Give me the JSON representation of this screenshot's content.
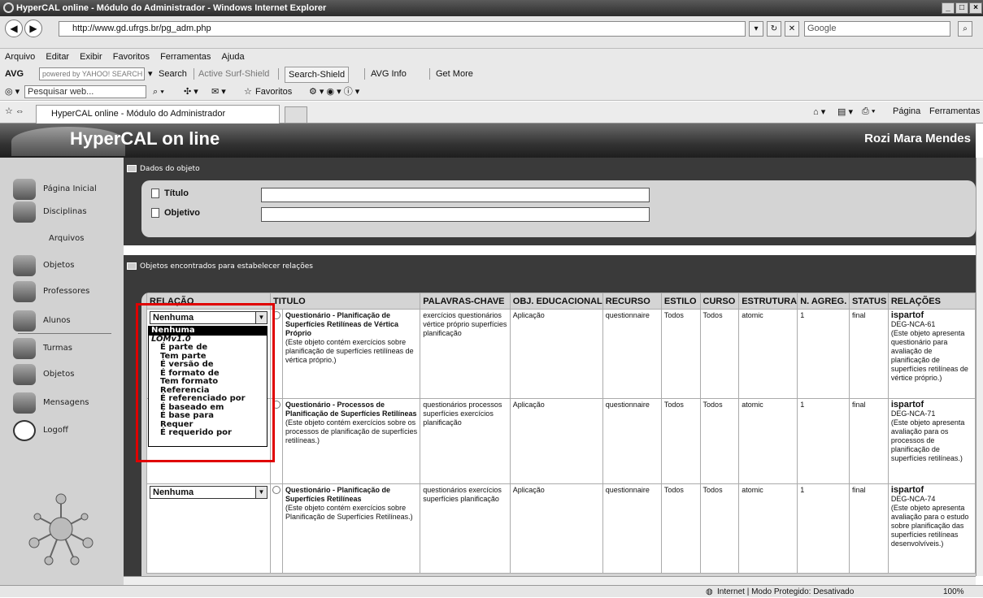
{
  "window": {
    "title": "HyperCAL online - Módulo do Administrador - Windows Internet Explorer",
    "url": "http://www.gd.ufrgs.br/pg_adm.php",
    "search_placeholder": "Google"
  },
  "menu": [
    "Arquivo",
    "Editar",
    "Exibir",
    "Favoritos",
    "Ferramentas",
    "Ajuda"
  ],
  "toolbar": {
    "avg_label": "AVG",
    "yahoo_label": "powered by YAHOO! SEARCH",
    "search_label": "Search",
    "active_surf": "Active Surf-Shield",
    "search_shield": "Search-Shield",
    "avg_info": "AVG Info",
    "get_more": "Get More",
    "web_search_placeholder": "Pesquisar web...",
    "favoritos": "Favoritos"
  },
  "tab": {
    "label": "HyperCAL online - Módulo do Administrador",
    "pagina": "Página",
    "ferramentas": "Ferramentas"
  },
  "app": {
    "title": "HyperCAL on line",
    "user": "Rozi Mara Mendes"
  },
  "sidebar": [
    {
      "label": "Página Inicial"
    },
    {
      "label": "Disciplinas"
    },
    {
      "label": "Arquivos"
    },
    {
      "label": "Objetos"
    },
    {
      "label": "Professores"
    },
    {
      "label": "Alunos"
    },
    {
      "label": "Turmas"
    },
    {
      "label": "Objetos"
    },
    {
      "label": "Mensagens"
    },
    {
      "label": "Logoff"
    }
  ],
  "form": {
    "section_title": "Dados do objeto",
    "titulo_label": "Título",
    "objetivo_label": "Objetivo",
    "titulo_value": "",
    "objetivo_value": ""
  },
  "results": {
    "section_title": "Objetos encontrados para estabelecer relações",
    "headers": [
      "RELAÇÃO",
      "TITULO",
      "PALAVRAS-CHAVE",
      "OBJ. EDUCACIONAL",
      "RECURSO",
      "ESTILO",
      "CURSO",
      "ESTRUTURA",
      "N. AGREG.",
      "STATUS",
      "RELAÇÕES"
    ],
    "rows": [
      {
        "relacao": "Nenhuma",
        "title": "Questionário - Planificação de Superfícies Retilíneas de Vértica Próprio",
        "desc": "(Este objeto contém exercícios sobre planificação de superfícies retilíneas de vértica próprio.)",
        "keywords": "exercícios questionários vértice próprio superfícies planificação",
        "obj": "Aplicação",
        "recurso": "questionnaire",
        "estilo": "Todos",
        "curso": "Todos",
        "estrutura": "atomic",
        "nagreg": "1",
        "status": "final",
        "rel_type": "ispartof",
        "rel_id": "DEG-NCA-61",
        "rel_desc": "(Este objeto apresenta questionário para avaliação de planificação de superfícies retilíneas de vértice próprio.)"
      },
      {
        "relacao": "",
        "title": "Questionário - Processos de Planificação de Superfícies Retilíneas",
        "desc": "(Este objeto contém exercícios sobre os processos de planificação de superfícies retilíneas.)",
        "keywords": "questionários processos superfícies exercícios planificação",
        "obj": "Aplicação",
        "recurso": "questionnaire",
        "estilo": "Todos",
        "curso": "Todos",
        "estrutura": "atomic",
        "nagreg": "1",
        "status": "final",
        "rel_type": "ispartof",
        "rel_id": "DEG-NCA-71",
        "rel_desc": "(Este objeto apresenta avaliação para os processos de planificação de superfícies retilíneas.)"
      },
      {
        "relacao": "Nenhuma",
        "title": "Questionário - Planificação de Superfícies Retilíneas",
        "desc": "(Este objeto contém exercícios sobre Planificação de Superfícies Retilíneas.)",
        "keywords": "questionários exercícios superfícies planificação",
        "obj": "Aplicação",
        "recurso": "questionnaire",
        "estilo": "Todos",
        "curso": "Todos",
        "estrutura": "atomic",
        "nagreg": "1",
        "status": "final",
        "rel_type": "ispartof",
        "rel_id": "DEG-NCA-74",
        "rel_desc": "(Este objeto apresenta avaliação para o estudo sobre planificação das superfícies retilíneas desenvolvíveis.)"
      }
    ]
  },
  "dropdown": {
    "options": [
      {
        "label": "Nenhuma",
        "kind": "selected"
      },
      {
        "label": "LOMv1.0",
        "kind": "group"
      },
      {
        "label": "É parte de",
        "kind": "indent"
      },
      {
        "label": "Tem parte",
        "kind": "indent"
      },
      {
        "label": "É versão de",
        "kind": "indent"
      },
      {
        "label": "É formato de",
        "kind": "indent"
      },
      {
        "label": "Tem formato",
        "kind": "indent"
      },
      {
        "label": "Referencia",
        "kind": "indent"
      },
      {
        "label": "É referenciado por",
        "kind": "indent"
      },
      {
        "label": "É baseado em",
        "kind": "indent"
      },
      {
        "label": "É base para",
        "kind": "indent"
      },
      {
        "label": "Requer",
        "kind": "indent"
      },
      {
        "label": "É requerido por",
        "kind": "indent"
      }
    ]
  },
  "status": {
    "zone": "Internet | Modo Protegido: Desativado",
    "zoom": "100%"
  }
}
